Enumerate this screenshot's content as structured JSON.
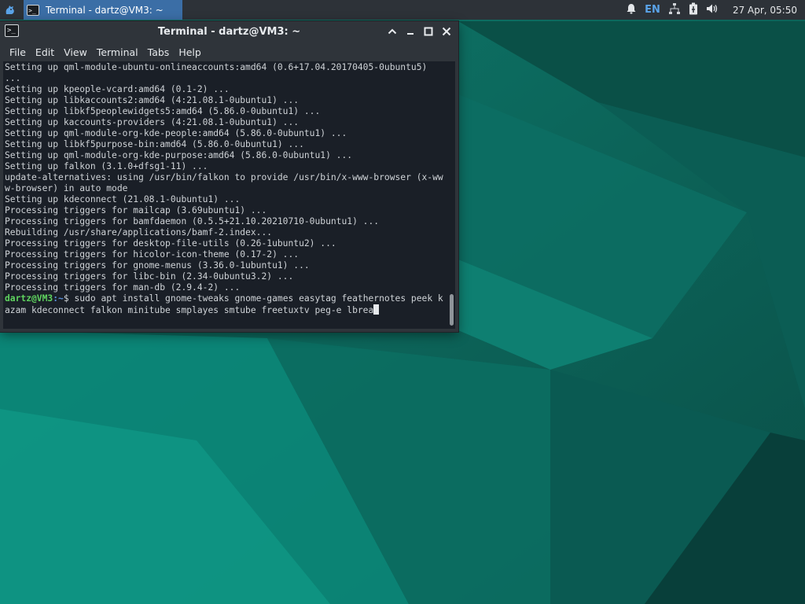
{
  "panel": {
    "taskbar_item": "Terminal - dartz@VM3: ~",
    "language": "EN",
    "clock": "27 Apr, 05:50",
    "icons": [
      "whisker-menu-icon",
      "terminal-icon",
      "notification-bell-icon",
      "network-icon",
      "battery-icon",
      "volume-icon"
    ]
  },
  "window": {
    "title": "Terminal - dartz@VM3: ~",
    "menu": [
      "File",
      "Edit",
      "View",
      "Terminal",
      "Tabs",
      "Help"
    ]
  },
  "terminal": {
    "output_lines": [
      "Setting up qml-module-ubuntu-onlineaccounts:amd64 (0.6+17.04.20170405-0ubuntu5)",
      "...",
      "Setting up kpeople-vcard:amd64 (0.1-2) ...",
      "Setting up libkaccounts2:amd64 (4:21.08.1-0ubuntu1) ...",
      "Setting up libkf5peoplewidgets5:amd64 (5.86.0-0ubuntu1) ...",
      "Setting up kaccounts-providers (4:21.08.1-0ubuntu1) ...",
      "Setting up qml-module-org-kde-people:amd64 (5.86.0-0ubuntu1) ...",
      "Setting up libkf5purpose-bin:amd64 (5.86.0-0ubuntu1) ...",
      "Setting up qml-module-org-kde-purpose:amd64 (5.86.0-0ubuntu1) ...",
      "Setting up falkon (3.1.0+dfsg1-11) ...",
      "update-alternatives: using /usr/bin/falkon to provide /usr/bin/x-www-browser (x-www-browser) in auto mode",
      "Setting up kdeconnect (21.08.1-0ubuntu1) ...",
      "Processing triggers for mailcap (3.69ubuntu1) ...",
      "Processing triggers for bamfdaemon (0.5.5+21.10.20210710-0ubuntu1) ...",
      "Rebuilding /usr/share/applications/bamf-2.index...",
      "Processing triggers for desktop-file-utils (0.26-1ubuntu2) ...",
      "Processing triggers for hicolor-icon-theme (0.17-2) ...",
      "Processing triggers for gnome-menus (3.36.0-1ubuntu1) ...",
      "Processing triggers for libc-bin (2.34-0ubuntu3.2) ...",
      "Processing triggers for man-db (2.9.4-2) ..."
    ],
    "prompt_user": "dartz@VM3",
    "prompt_path": ":~",
    "prompt_symbol": "$ ",
    "command": "sudo apt install gnome-tweaks gnome-games easytag feathernotes peek kazam kdeconnect falkon minitube smplayes smtube freetuxtv peg-e lbrea"
  },
  "colors": {
    "panel_bg": "#2d3238",
    "taskbar_active": "#3b6ea6",
    "terminal_bg": "#1a1f27",
    "prompt_green": "#5fd35f",
    "prompt_blue": "#5b8fd9",
    "wallpaper_teal": "#0d6b5f"
  }
}
